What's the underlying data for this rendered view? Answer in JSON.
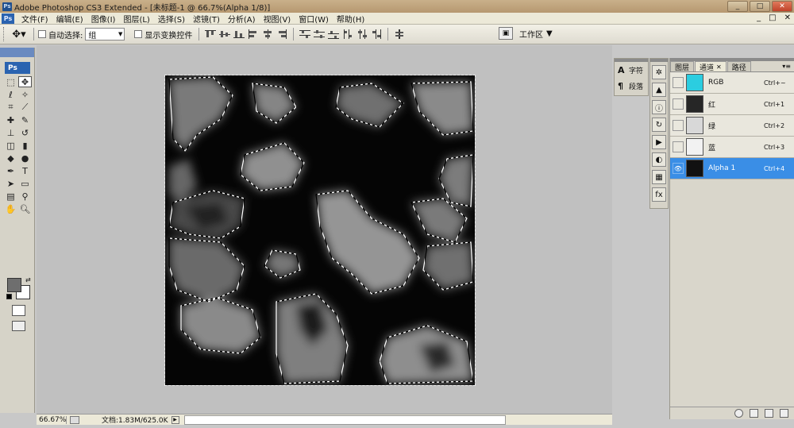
{
  "window": {
    "app_badge": "Ps",
    "title": "Adobe Photoshop CS3 Extended - [未标题-1 @ 66.7%(Alpha 1/8)]",
    "controls": {
      "minimize": "_",
      "maximize": "□",
      "close": "✕"
    }
  },
  "menu": {
    "items": [
      "文件(F)",
      "编辑(E)",
      "图像(I)",
      "图层(L)",
      "选择(S)",
      "滤镜(T)",
      "分析(A)",
      "视图(V)",
      "窗口(W)",
      "帮助(H)"
    ],
    "doc_controls": {
      "minimize": "_",
      "restore": "□",
      "close": "✕"
    }
  },
  "options": {
    "auto_select_label": "自动选择:",
    "auto_select_value": "组",
    "show_transform_label": "显示变换控件",
    "workspace_label": "工作区"
  },
  "toolbox": {
    "badge": "Ps",
    "tools": [
      {
        "name": "marquee-tool",
        "glyph": "⬚"
      },
      {
        "name": "move-tool",
        "glyph": "✥",
        "active": true
      },
      {
        "name": "lasso-tool",
        "glyph": "ℓ"
      },
      {
        "name": "magic-wand-tool",
        "glyph": "✧"
      },
      {
        "name": "crop-tool",
        "glyph": "⌗"
      },
      {
        "name": "slice-tool",
        "glyph": "⟋"
      },
      {
        "name": "healing-tool",
        "glyph": "✚"
      },
      {
        "name": "brush-tool",
        "glyph": "✎"
      },
      {
        "name": "stamp-tool",
        "glyph": "⊥"
      },
      {
        "name": "history-brush-tool",
        "glyph": "↺"
      },
      {
        "name": "eraser-tool",
        "glyph": "◫"
      },
      {
        "name": "gradient-tool",
        "glyph": "▮"
      },
      {
        "name": "blur-tool",
        "glyph": "◆"
      },
      {
        "name": "dodge-tool",
        "glyph": "●"
      },
      {
        "name": "pen-tool",
        "glyph": "✒"
      },
      {
        "name": "type-tool",
        "glyph": "T"
      },
      {
        "name": "path-select-tool",
        "glyph": "➤"
      },
      {
        "name": "shape-tool",
        "glyph": "▭"
      },
      {
        "name": "notes-tool",
        "glyph": "▤"
      },
      {
        "name": "eyedropper-tool",
        "glyph": "⚲"
      },
      {
        "name": "hand-tool",
        "glyph": "✋"
      },
      {
        "name": "zoom-tool",
        "glyph": "🔍︎"
      }
    ]
  },
  "status": {
    "zoom": "66.67%",
    "doc_info": "文档:1.83M/625.0K"
  },
  "side_panel": {
    "character_label": "字符",
    "paragraph_label": "段落"
  },
  "channels": {
    "tabs": [
      "图层",
      "通道",
      "路径"
    ],
    "active_tab": 1,
    "rows": [
      {
        "name": "RGB",
        "shortcut": "Ctrl+~",
        "thumb_color": "#2bcde0",
        "visible": false,
        "selected": false
      },
      {
        "name": "红",
        "shortcut": "Ctrl+1",
        "thumb_color": "#262626",
        "visible": false,
        "selected": false
      },
      {
        "name": "绿",
        "shortcut": "Ctrl+2",
        "thumb_color": "#d8d8d8",
        "visible": false,
        "selected": false
      },
      {
        "name": "蓝",
        "shortcut": "Ctrl+3",
        "thumb_color": "#f2f2f2",
        "visible": false,
        "selected": false
      },
      {
        "name": "Alpha 1",
        "shortcut": "Ctrl+4",
        "thumb_color": "#111111",
        "visible": true,
        "selected": true
      }
    ]
  },
  "colors": {
    "selection": "#3a8ee6",
    "foreground": "#6e6e6e",
    "background": "#ffffff"
  }
}
